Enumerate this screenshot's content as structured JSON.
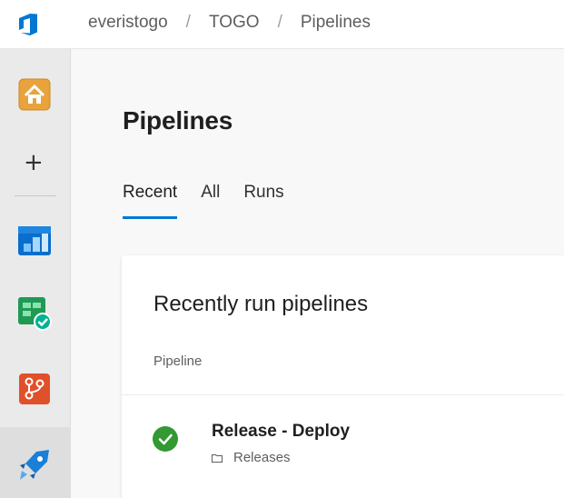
{
  "header": {
    "breadcrumb": [
      "everistogo",
      "TOGO",
      "Pipelines"
    ],
    "separator": "/"
  },
  "rail": {
    "items": [
      {
        "icon": "project-home-icon"
      },
      {
        "icon": "plus-icon",
        "glyph": "+"
      },
      {
        "icon": "boards-icon"
      },
      {
        "icon": "test-plans-icon"
      },
      {
        "icon": "repos-icon"
      },
      {
        "icon": "pipelines-icon",
        "active": true
      }
    ]
  },
  "main": {
    "title": "Pipelines",
    "tabs": [
      {
        "label": "Recent",
        "active": true
      },
      {
        "label": "All",
        "active": false
      },
      {
        "label": "Runs",
        "active": false
      }
    ],
    "card": {
      "title": "Recently run pipelines",
      "column_header": "Pipeline",
      "rows": [
        {
          "name": "Release - Deploy",
          "folder": "Releases",
          "status": "succeeded"
        }
      ]
    }
  },
  "colors": {
    "accent": "#0078d4",
    "success": "#339933",
    "repos": "#e0502b"
  }
}
